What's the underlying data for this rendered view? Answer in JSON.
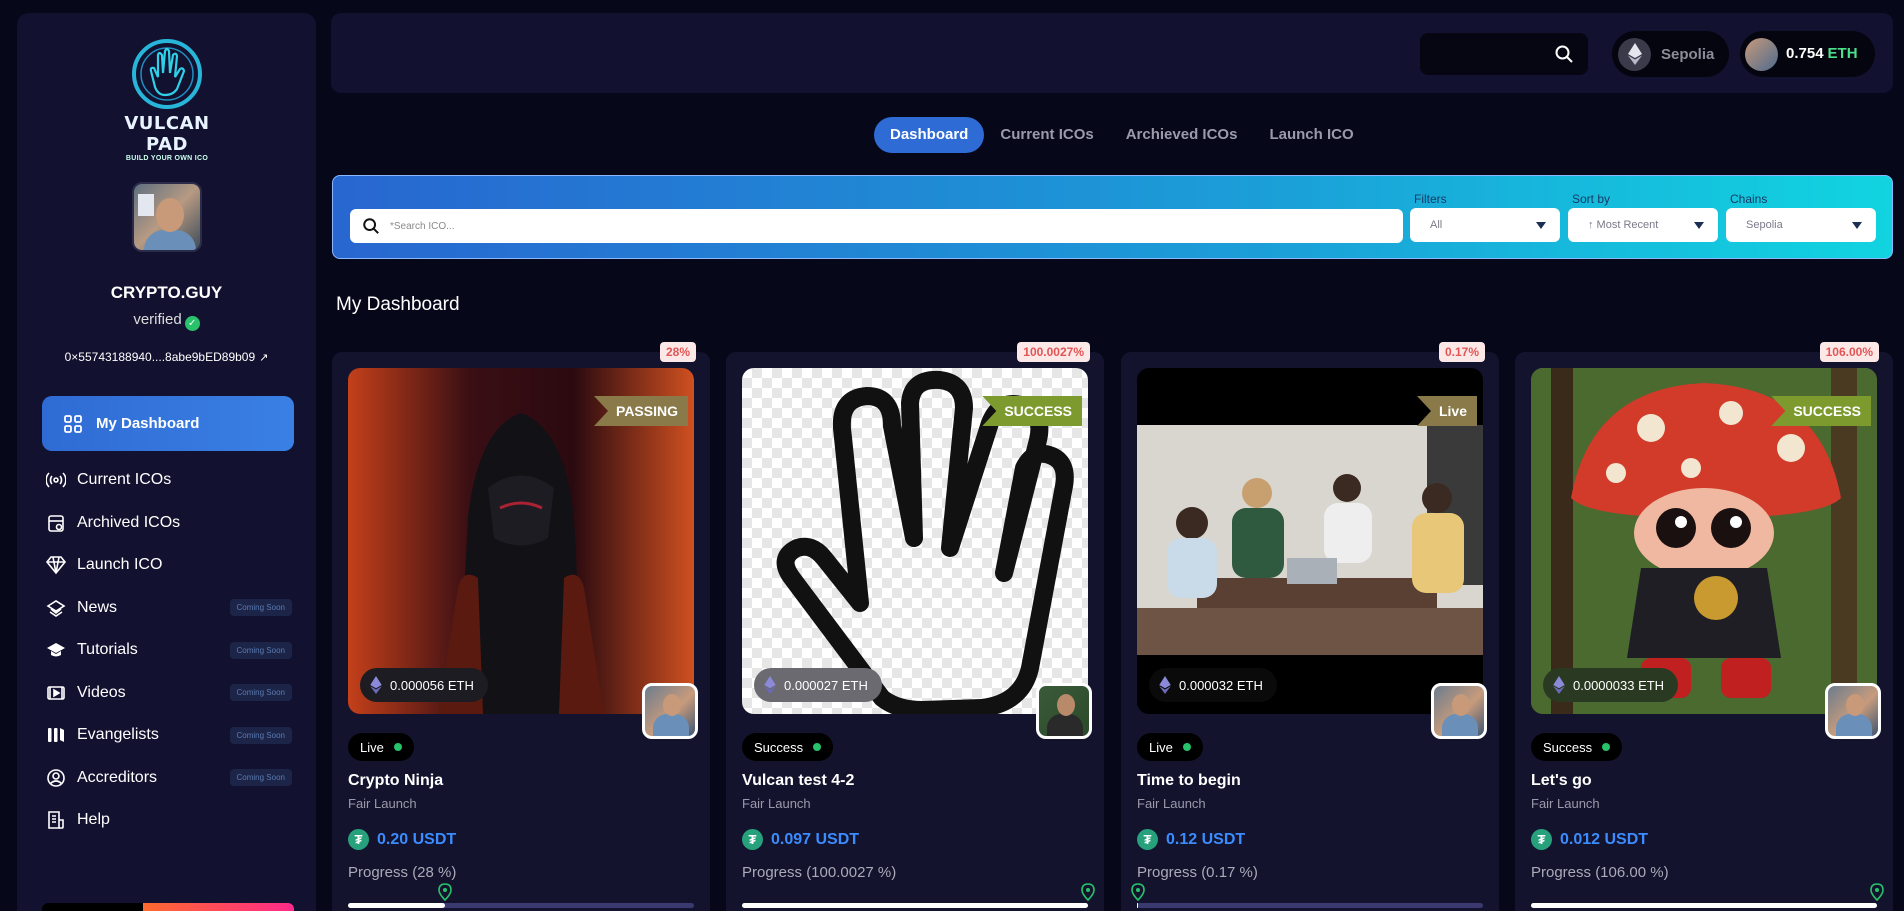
{
  "app": {
    "logo_title": "VULCAN PAD",
    "logo_subtitle": "BUILD YOUR OWN ICO"
  },
  "profile": {
    "username": "CRYPTO.GUY",
    "verified": "verified",
    "address": "0×55743188940....8abe9bED89b09"
  },
  "sidebar": {
    "active": "My Dashboard",
    "items": [
      {
        "label": "Current ICOs",
        "icon": "broadcast-icon",
        "soon": ""
      },
      {
        "label": "Archived ICOs",
        "icon": "archive-icon",
        "soon": ""
      },
      {
        "label": "Launch ICO",
        "icon": "diamond-icon",
        "soon": ""
      },
      {
        "label": "News",
        "icon": "news-icon",
        "soon": "Coming Soon"
      },
      {
        "label": "Tutorials",
        "icon": "graduation-cap-icon",
        "soon": "Coming Soon"
      },
      {
        "label": "Videos",
        "icon": "video-icon",
        "soon": "Coming Soon"
      },
      {
        "label": "Evangelists",
        "icon": "bars-icon",
        "soon": "Coming Soon"
      },
      {
        "label": "Accreditors",
        "icon": "user-circle-icon",
        "soon": "Coming Soon"
      },
      {
        "label": "Help",
        "icon": "help-doc-icon",
        "soon": ""
      }
    ]
  },
  "topbar": {
    "chain": "Sepolia",
    "balance": "0.754",
    "balance_unit": "ETH"
  },
  "tabs": [
    "Dashboard",
    "Current ICOs",
    "Archieved ICOs",
    "Launch ICO"
  ],
  "search_panel": {
    "placeholder": "*Search ICO...",
    "filters_label": "Filters",
    "filters_value": "All",
    "sort_label": "Sort by",
    "sort_value": "↑  Most Recent",
    "chains_label": "Chains",
    "chains_value": "Sepolia"
  },
  "section_title": "My Dashboard",
  "cards": [
    {
      "percent": "28%",
      "ribbon": "PASSING",
      "ribbon_color": "#8a7a4a",
      "price": "0.000056 ETH",
      "status": "Live",
      "title": "Crypto Ninja",
      "subtitle": "Fair Launch",
      "usdt": "0.20 USDT",
      "progress_label": "Progress (28 %)",
      "progress_value": 0.28
    },
    {
      "percent": "100.0027%",
      "ribbon": "SUCCESS",
      "ribbon_color": "#7c9a2e",
      "price": "0.000027 ETH",
      "status": "Success",
      "title": "Vulcan test 4-2",
      "subtitle": "Fair Launch",
      "usdt": "0.097 USDT",
      "progress_label": "Progress (100.0027 %)",
      "progress_value": 1.0
    },
    {
      "percent": "0.17%",
      "ribbon": "Live",
      "ribbon_color": "#8a7a4a",
      "price": "0.000032 ETH",
      "status": "Live",
      "title": "Time to begin",
      "subtitle": "Fair Launch",
      "usdt": "0.12 USDT",
      "progress_label": "Progress (0.17 %)",
      "progress_value": 0.0017
    },
    {
      "percent": "106.00%",
      "ribbon": "SUCCESS",
      "ribbon_color": "#7c9a2e",
      "price": "0.0000033 ETH",
      "status": "Success",
      "title": "Let's go",
      "subtitle": "Fair Launch",
      "usdt": "0.012 USDT",
      "progress_label": "Progress (106.00 %)",
      "progress_value": 1.0
    }
  ]
}
